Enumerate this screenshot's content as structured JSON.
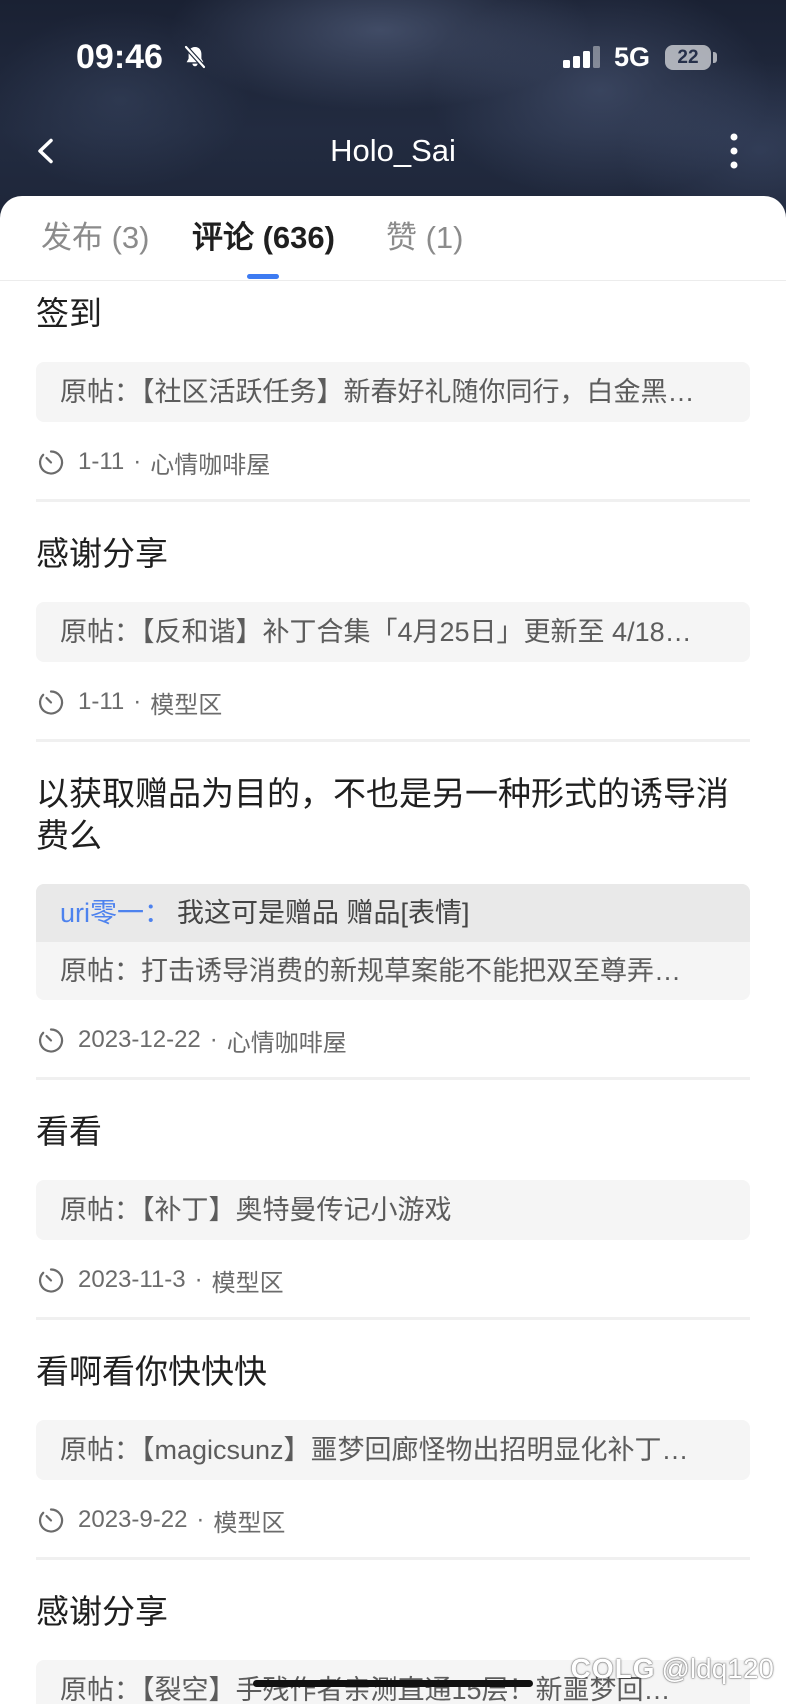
{
  "status_bar": {
    "time": "09:46",
    "silent_icon": "bell-slash-icon",
    "signal_icon": "signal-icon",
    "network": "5G",
    "battery": "22"
  },
  "nav": {
    "back_icon": "back-chevron-icon",
    "title": "Holo_Sai",
    "more_icon": "more-vertical-icon"
  },
  "tabs": [
    {
      "label": "发布 (3)",
      "active": false
    },
    {
      "label": "评论 (636)",
      "active": true
    },
    {
      "label": "赞 (1)",
      "active": false
    }
  ],
  "meta_separator": "·",
  "comments": [
    {
      "text": "签到",
      "quote": "原帖：【社区活跃任务】新春好礼随你同行，白金黑…",
      "date": "1-11",
      "board": "心情咖啡屋"
    },
    {
      "text": "感谢分享",
      "quote": "原帖：【反和谐】补丁合集「4月25日」更新至 4/18…",
      "date": "1-11",
      "board": "模型区"
    },
    {
      "text": "以获取赠品为目的，不也是另一种形式的诱导消费么",
      "reply": {
        "name": "uri零一：",
        "text": "我这可是赠品 赠品[表情]"
      },
      "quote": "原帖：打击诱导消费的新规草案能不能把双至尊弄…",
      "date": "2023-12-22",
      "board": "心情咖啡屋"
    },
    {
      "text": "看看",
      "quote": "原帖：【补丁】奥特曼传记小游戏",
      "date": "2023-11-3",
      "board": "模型区"
    },
    {
      "text": "看啊看你快快快",
      "quote": "原帖：【magicsunz】噩梦回廊怪物出招明显化补丁…",
      "date": "2023-9-22",
      "board": "模型区"
    },
    {
      "text": "感谢分享",
      "quote": "原帖：【裂空】手残作者亲测直通15层！新噩梦回…"
    }
  ],
  "meta_icon": "clock-icon",
  "watermark": {
    "logo": "COLG",
    "handle": "@ldq120"
  },
  "colors": {
    "accent": "#3d7bf2",
    "reply_name": "#4d82ee",
    "title_text": "#1f1f1f",
    "secondary_text": "#5c5c5c",
    "quote_bg": "#f5f5f5",
    "reply_bg": "#e9e9e9"
  }
}
